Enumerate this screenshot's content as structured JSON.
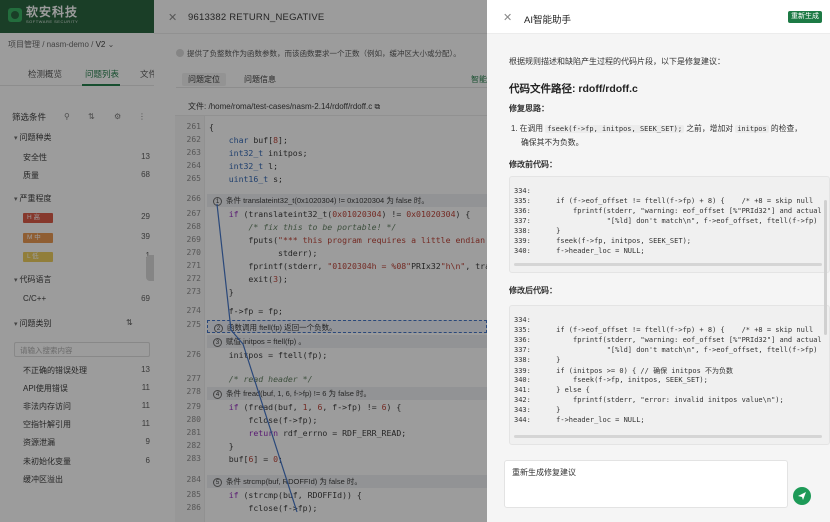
{
  "app": {
    "logo_cn": "软安科技",
    "logo_en": "SOFTWARE SECURITY",
    "breadcrumb": [
      "项目管理",
      "nasm-demo",
      "V2"
    ],
    "tabs": [
      "检测概览",
      "问题列表",
      "文件"
    ],
    "filter_label": "筛选条件",
    "search_placeholder": "请输入搜索内容"
  },
  "filters": {
    "groups": [
      {
        "label": "问题种类",
        "items": [
          {
            "label": "安全性",
            "count": "13"
          },
          {
            "label": "质量",
            "count": "68"
          }
        ]
      },
      {
        "label": "严重程度",
        "items": [
          {
            "label": "H 高",
            "count": "29"
          },
          {
            "label": "M 中",
            "count": "39"
          },
          {
            "label": "L 低",
            "count": "1"
          }
        ]
      },
      {
        "label": "代码语言",
        "items": [
          {
            "label": "C/C++",
            "count": "69"
          }
        ]
      },
      {
        "label": "问题类别",
        "items": []
      }
    ],
    "categories": [
      {
        "label": "不正确的错误处理",
        "count": "13"
      },
      {
        "label": "API使用错误",
        "count": "11"
      },
      {
        "label": "非法内存访问",
        "count": "11"
      },
      {
        "label": "空指针解引用",
        "count": "11"
      },
      {
        "label": "资源泄漏",
        "count": "9"
      },
      {
        "label": "未初始化变量",
        "count": "6"
      },
      {
        "label": "缓冲区溢出",
        "count": ""
      }
    ]
  },
  "issue": {
    "title": "9613382 RETURN_NEGATIVE",
    "hint": "提供了负整数作为函数参数，而该函数要求一个正数（例如，缓冲区大小或分配）。",
    "tabs": [
      "问题定位",
      "问题信息"
    ],
    "ai_link": "智能",
    "file_label": "文件:",
    "file_path": "/home/roma/test-cases/nasm-2.14/rdoff/rdoff.c"
  },
  "code": {
    "line_numbers": [
      "261",
      "262",
      "263",
      "264",
      "265",
      "266",
      "267",
      "268",
      "269",
      "270",
      "271",
      "272",
      "273",
      "274",
      "275",
      "276",
      "277",
      "278",
      "279",
      "280",
      "281",
      "282",
      "283",
      "284",
      "285",
      "286"
    ],
    "annotations": [
      {
        "num": "1",
        "text": "条件 translateint32_t(0x1020304) != 0x1020304 为 false 时。"
      },
      {
        "num": "2",
        "text": "函数调用 ftell(fp) 返回一个负数。"
      },
      {
        "num": "3",
        "text": "赋值 initpos = ftell(fp) 。"
      },
      {
        "num": "4",
        "text": "条件 fread(buf, 1, 6, f->fp) != 6 为 false 时。"
      },
      {
        "num": "5",
        "text": "条件 strcmp(buf, RDOFFId) 为 false 时。"
      }
    ]
  },
  "ai": {
    "title": "AI智能助手",
    "regen_label": "重新生成",
    "intro": "根据规则描述和缺陷产生过程的代码片段，以下是修复建议：",
    "file_heading": "代码文件路径: rdoff/rdoff.c",
    "idea_heading": "修复思路：",
    "idea_prefix": "1. 在调用",
    "idea_code1": "fseek(f->fp, initpos, SEEK_SET);",
    "idea_mid": "之前，增加对",
    "idea_code2": "initpos",
    "idea_suffix": "的检查，",
    "idea_line2": "确保其不为负数。",
    "before_heading": "修改前代码：",
    "before_lines": [
      "334:",
      "335:      if (f->eof_offset != ftell(f->fp) + 8) {    /* +8 = skip null",
      "336:          fprintf(stderr, \"warning: eof_offset [%\"PRId32\"] and actual",
      "337:                  \"[%ld] don't match\\n\", f->eof_offset, ftell(f->fp)",
      "338:      }",
      "339:      fseek(f->fp, initpos, SEEK_SET);",
      "340:      f->header_loc = NULL;"
    ],
    "after_heading": "修改后代码：",
    "after_lines": [
      "334:",
      "335:      if (f->eof_offset != ftell(f->fp) + 8) {    /* +8 = skip null",
      "336:          fprintf(stderr, \"warning: eof_offset [%\"PRId32\"] and actual",
      "337:                  \"[%ld] don't match\\n\", f->eof_offset, ftell(f->fp)",
      "338:      }",
      "339:      if (initpos >= 0) { // 确保 initpos 不为负数",
      "340:          fseek(f->fp, initpos, SEEK_SET);",
      "341:      } else {",
      "342:          fprintf(stderr, \"error: invalid initpos value\\n\");",
      "343:      }",
      "344:      f->header_loc = NULL;"
    ],
    "input_text": "重新生成修复建议"
  },
  "colors": {
    "brand": "#1f5e36",
    "accent": "#1d7a45",
    "high": "#d9533f",
    "medium": "#e8954a",
    "low": "#eccb57"
  }
}
